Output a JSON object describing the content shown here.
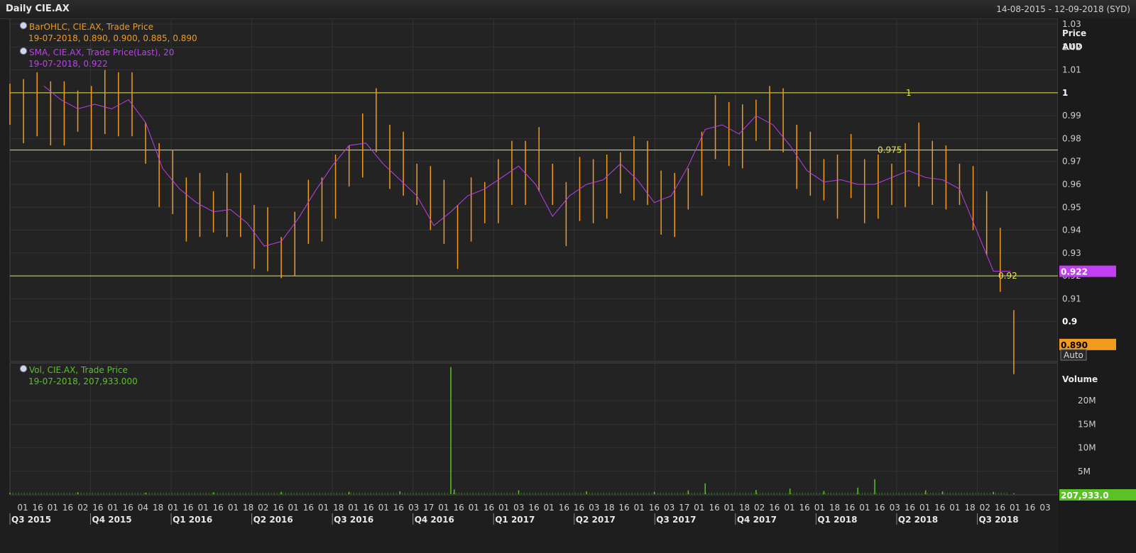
{
  "header": {
    "title": "Daily CIE.AX",
    "date_range": "14-08-2015 - 12-09-2018 (SYD)"
  },
  "legend": {
    "ohlc_name": "BarOHLC, CIE.AX, Trade Price",
    "ohlc_value": "19-07-2018, 0.890, 0.900, 0.885, 0.890",
    "sma_name": "SMA, CIE.AX, Trade Price(Last),  20",
    "sma_value": "19-07-2018, 0.922",
    "vol_name": "Vol, CIE.AX, Trade Price",
    "vol_value": "19-07-2018, 207,933.000"
  },
  "axis_labels": {
    "price": "Price",
    "currency": "AUD",
    "volume": "Volume",
    "auto": "Auto"
  },
  "colors": {
    "ohlc": "#f29a1c",
    "sma": "#c03ff0",
    "volume": "#5ac224",
    "hline": "#e6e650",
    "background": "#1e1e1e"
  },
  "chart_data": [
    {
      "type": "line",
      "title": "Daily CIE.AX",
      "ylabel": "Price AUD",
      "ylim": [
        0.885,
        1.035
      ],
      "y_ticks": [
        1.03,
        1.02,
        1.01,
        1,
        0.99,
        0.98,
        0.97,
        0.96,
        0.95,
        0.94,
        0.93,
        0.92,
        0.91,
        0.9
      ],
      "y_tick_labels": [
        "1.03",
        "1.02",
        "1.01",
        "1",
        "0.99",
        "0.98",
        "0.97",
        "0.96",
        "0.95",
        "0.94",
        "0.93",
        "0.92",
        "0.91",
        "0.9"
      ],
      "bold_ticks": [
        "1",
        "0.9"
      ],
      "horizontal_lines": [
        {
          "value": 1.0,
          "label": "1"
        },
        {
          "value": 0.975,
          "label": "0.975"
        },
        {
          "value": 0.92,
          "label": "0.92"
        }
      ],
      "markers": [
        {
          "label": "0.922",
          "value": 0.922,
          "color": "#c03ff0"
        },
        {
          "label": "0.890",
          "value": 0.89,
          "color": "#f29a1c"
        }
      ],
      "series": [
        {
          "name": "BarOHLC, CIE.AX, Trade Price",
          "style": "ohlc",
          "x": [
            0.0,
            0.04,
            0.08,
            0.12,
            0.16,
            0.2,
            0.24,
            0.28,
            0.32,
            0.36,
            0.4,
            0.44,
            0.48,
            0.52,
            0.56,
            0.6,
            0.64,
            0.68,
            0.72,
            0.76,
            0.8,
            0.84,
            0.88,
            0.92,
            0.96,
            1.0,
            1.04,
            1.08,
            1.12,
            1.16,
            1.2,
            1.24,
            1.28,
            1.32,
            1.36,
            1.4,
            1.44,
            1.48,
            1.52,
            1.56,
            1.6,
            1.64,
            1.68,
            1.72,
            1.76,
            1.8,
            1.84,
            1.88,
            1.92,
            1.96,
            2.0,
            2.04,
            2.08,
            2.12,
            2.16,
            2.2,
            2.24,
            2.28,
            2.32,
            2.36,
            2.4,
            2.44,
            2.48,
            2.52,
            2.56,
            2.6,
            2.64,
            2.68,
            2.72,
            2.76,
            2.8,
            2.84,
            2.88,
            2.92,
            2.96
          ],
          "values": [
            0.995,
            0.993,
            0.992,
            0.994,
            0.99,
            0.992,
            0.99,
            0.993,
            0.998,
            0.994,
            0.978,
            0.965,
            0.958,
            0.952,
            0.95,
            0.948,
            0.952,
            0.948,
            0.94,
            0.935,
            0.928,
            0.935,
            0.945,
            0.952,
            0.958,
            0.968,
            0.978,
            0.985,
            0.975,
            0.968,
            0.96,
            0.955,
            0.945,
            0.94,
            0.948,
            0.952,
            0.958,
            0.962,
            0.968,
            0.97,
            0.96,
            0.948,
            0.955,
            0.96,
            0.958,
            0.965,
            0.968,
            0.962,
            0.955,
            0.95,
            0.958,
            0.97,
            0.982,
            0.985,
            0.98,
            0.988,
            0.99,
            0.985,
            0.975,
            0.968,
            0.962,
            0.96,
            0.965,
            0.96,
            0.958,
            0.96,
            0.965,
            0.97,
            0.968,
            0.962,
            0.96,
            0.955,
            0.94,
            0.93,
            0.89
          ]
        },
        {
          "name": "SMA, CIE.AX, Trade Price(Last),  20",
          "style": "line",
          "x": [
            0.1,
            0.15,
            0.2,
            0.25,
            0.3,
            0.35,
            0.4,
            0.45,
            0.5,
            0.55,
            0.6,
            0.65,
            0.7,
            0.75,
            0.8,
            0.85,
            0.9,
            0.95,
            1.0,
            1.05,
            1.1,
            1.15,
            1.2,
            1.25,
            1.3,
            1.35,
            1.4,
            1.45,
            1.5,
            1.55,
            1.6,
            1.65,
            1.7,
            1.75,
            1.8,
            1.85,
            1.9,
            1.95,
            2.0,
            2.05,
            2.1,
            2.15,
            2.2,
            2.25,
            2.3,
            2.35,
            2.4,
            2.45,
            2.5,
            2.55,
            2.6,
            2.65,
            2.7,
            2.75,
            2.8,
            2.85,
            2.9,
            2.95
          ],
          "values": [
            1.003,
            0.997,
            0.993,
            0.995,
            0.993,
            0.997,
            0.987,
            0.967,
            0.958,
            0.952,
            0.948,
            0.949,
            0.943,
            0.933,
            0.935,
            0.945,
            0.957,
            0.968,
            0.977,
            0.978,
            0.969,
            0.962,
            0.955,
            0.942,
            0.948,
            0.955,
            0.958,
            0.963,
            0.968,
            0.96,
            0.946,
            0.955,
            0.96,
            0.962,
            0.969,
            0.962,
            0.952,
            0.955,
            0.968,
            0.984,
            0.986,
            0.982,
            0.99,
            0.986,
            0.977,
            0.966,
            0.961,
            0.962,
            0.96,
            0.96,
            0.963,
            0.966,
            0.963,
            0.962,
            0.958,
            0.94,
            0.922,
            0.922
          ]
        }
      ]
    },
    {
      "type": "bar",
      "ylabel": "Volume",
      "ylim": [
        0,
        28000000
      ],
      "y_ticks": [
        20000000,
        15000000,
        10000000,
        5000000
      ],
      "y_tick_labels": [
        "20M",
        "15M",
        "10M",
        "5M"
      ],
      "marker": {
        "label": "207,933.0",
        "value": 207933
      },
      "series": [
        {
          "name": "Vol, CIE.AX, Trade Price",
          "x": [
            0.0,
            0.2,
            0.4,
            0.6,
            0.8,
            1.0,
            1.15,
            1.3,
            1.31,
            1.5,
            1.7,
            1.9,
            2.0,
            2.05,
            2.2,
            2.3,
            2.4,
            2.5,
            2.55,
            2.7,
            2.75,
            2.9,
            2.96
          ],
          "values": [
            300000,
            400000,
            300000,
            400000,
            500000,
            500000,
            600000,
            27000000,
            1000000,
            800000,
            600000,
            500000,
            800000,
            2300000,
            900000,
            1200000,
            700000,
            1400000,
            3200000,
            800000,
            600000,
            500000,
            207933
          ]
        }
      ]
    }
  ],
  "x_axis": {
    "day_ticks": [
      "01",
      "16",
      "01",
      "16",
      "02",
      "16",
      "01",
      "16",
      "04",
      "18",
      "01",
      "16",
      "01",
      "16",
      "01",
      "18",
      "02",
      "16",
      "01",
      "16",
      "01",
      "18",
      "01",
      "16",
      "01",
      "16",
      "03",
      "17",
      "01",
      "16",
      "01",
      "16",
      "01",
      "03",
      "16",
      "01",
      "16",
      "16",
      "03",
      "18",
      "16",
      "01",
      "16",
      "03",
      "17",
      "01",
      "16",
      "01",
      "18",
      "02",
      "16",
      "01",
      "16",
      "01",
      "18",
      "16",
      "01",
      "16",
      "03",
      "16",
      "01",
      "16",
      "01",
      "18",
      "02",
      "16",
      "01",
      "16",
      "03"
    ],
    "quarters": [
      "Q3 2015",
      "Q4 2015",
      "Q1 2016",
      "Q2 2016",
      "Q3 2016",
      "Q4 2016",
      "Q1 2017",
      "Q2 2017",
      "Q3 2017",
      "Q4 2017",
      "Q1 2018",
      "Q2 2018",
      "Q3 2018"
    ]
  }
}
